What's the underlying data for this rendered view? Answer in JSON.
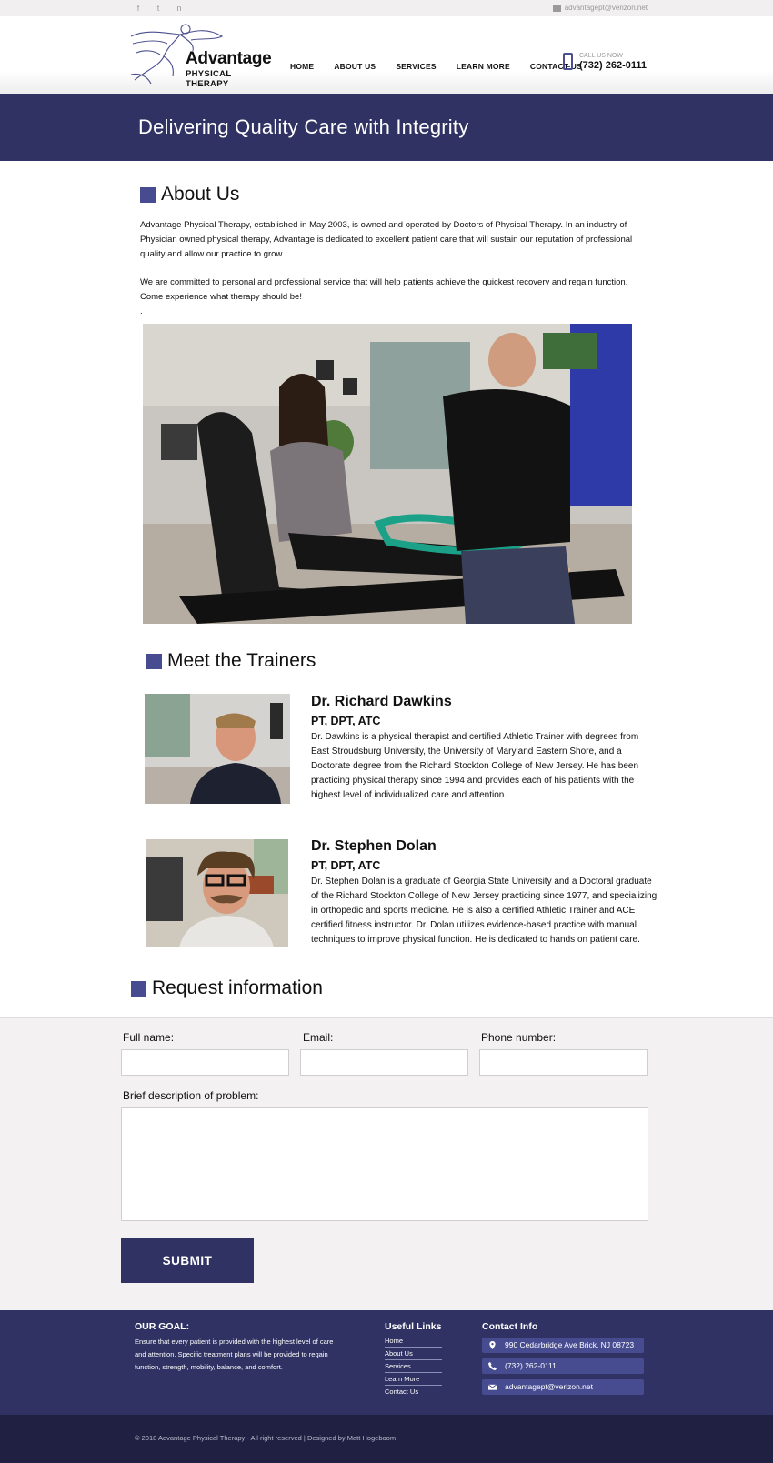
{
  "topbar": {
    "email": "advantagept@verizon.net",
    "social": [
      "f",
      "t",
      "in"
    ]
  },
  "header": {
    "brand": "Advantage",
    "brand_sub": "PHYSICAL THERAPY",
    "nav": [
      "HOME",
      "ABOUT US",
      "SERVICES",
      "LEARN MORE",
      "CONTACT US"
    ],
    "call_label": "CALL US NOW",
    "call_number": "(732) 262-0111"
  },
  "hero": {
    "title": "Delivering Quality Care with Integrity"
  },
  "about": {
    "heading": "About Us",
    "p1": "Advantage Physical Therapy, established in May 2003, is owned and operated by Doctors of Physical Therapy.  In an industry of Physician owned physical therapy, Advantage is dedicated to excellent patient care that will sustain our reputation of professional quality and allow our practice to grow.",
    "p2": "We are committed to personal and professional service that will help patients achieve the quickest recovery and regain function. Come experience what therapy should be!",
    "p3": "."
  },
  "trainers": {
    "heading": "Meet the Trainers",
    "items": [
      {
        "name": "Dr. Richard Dawkins",
        "cred": "PT, DPT, ATC",
        "bio": "Dr. Dawkins is a physical therapist and certified Athletic Trainer with degrees from East Stroudsburg University, the University of Maryland Eastern Shore, and a Doctorate degree from the Richard Stockton College of New Jersey. He has been practicing physical therapy since 1994 and provides each of his patients with the highest level of individualized care and attention."
      },
      {
        "name": "Dr. Stephen Dolan",
        "cred": "PT, DPT, ATC",
        "bio": "Dr. Stephen Dolan is a graduate of Georgia State University and a Doctoral graduate of the Richard Stockton College of New Jersey practicing since 1977, and specializing in orthopedic and sports medicine. He is also a certified Athletic Trainer and ACE certified fitness instructor. Dr. Dolan utilizes evidence-based practice with manual techniques to improve physical function. He is dedicated to hands on patient care."
      }
    ]
  },
  "request": {
    "heading": "Request information",
    "full_name_label": "Full name:",
    "email_label": "Email:",
    "phone_label": "Phone number:",
    "description_label": "Brief description of problem:",
    "full_name_value": "",
    "email_value": "",
    "phone_value": "",
    "description_value": "",
    "submit_label": "SUBMIT"
  },
  "footer": {
    "goal_heading": "OUR GOAL:",
    "goal_text": "Ensure that every patient is provided with the highest level of care and attention. Specific treatment plans will be provided to regain function, strength, mobility, balance, and comfort.",
    "links_heading": "Useful Links",
    "links": [
      "Home",
      "About Us",
      "Services",
      "Learn More",
      "Contact Us"
    ],
    "contact_heading": "Contact Info",
    "address": "990 Cedarbridge Ave Brick, NJ 08723",
    "phone": "(732) 262-0111",
    "email": "advantagept@verizon.net",
    "copyright": "© 2018 Advantage Physical Therapy -  All right reserved  |  Designed by Matt Hogeboom"
  },
  "colors": {
    "navy": "#2f3262",
    "accent": "#474c91",
    "footer_bottom": "#1f2042"
  }
}
